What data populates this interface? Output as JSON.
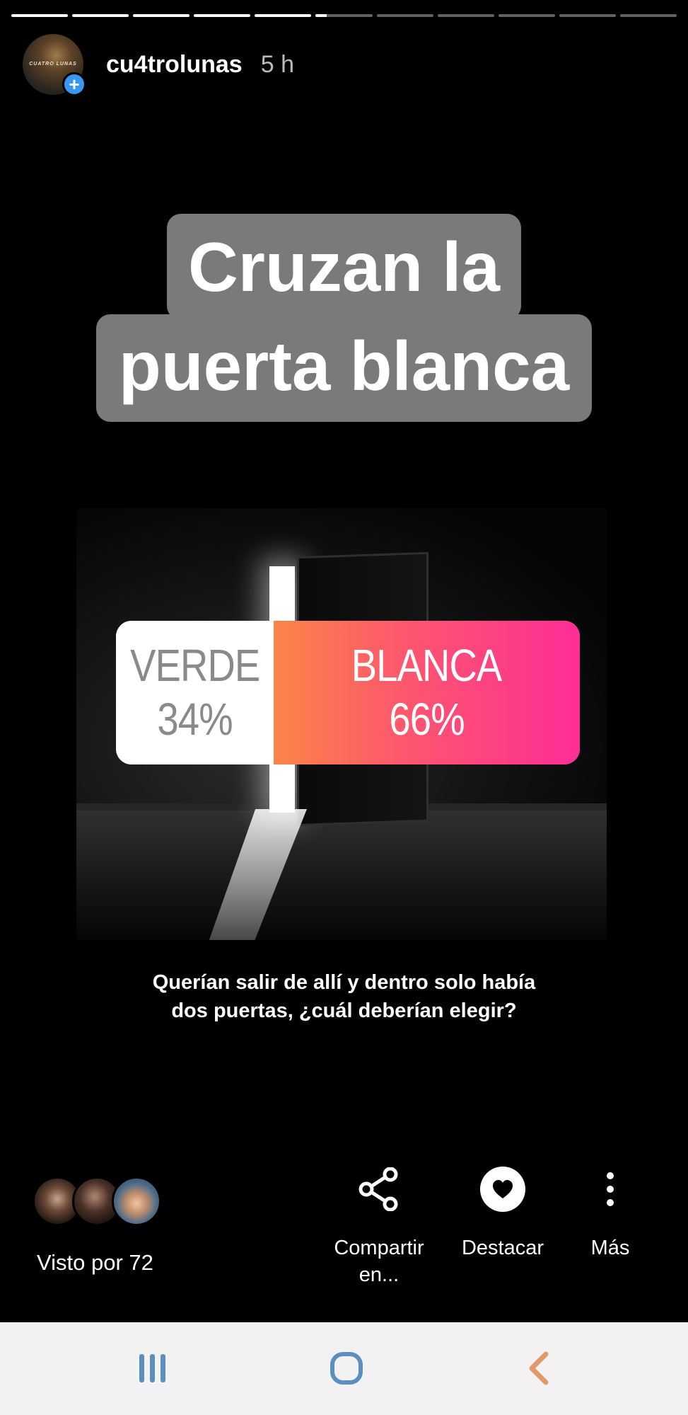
{
  "story": {
    "username": "cu4trolunas",
    "timestamp": "5 h",
    "avatar_text": "CUATRO LUNAS",
    "progress": {
      "segment_count": 11,
      "completed_segments": 5,
      "current_segment_fill": 0.2
    }
  },
  "title": {
    "line1": "Cruzan la",
    "line2": "puerta blanca"
  },
  "poll": {
    "options": [
      {
        "label": "VERDE",
        "percent": "34%",
        "value": 34
      },
      {
        "label": "BLANCA",
        "percent": "66%",
        "value": 66
      }
    ]
  },
  "caption": {
    "line1": "Querían salir de allí y dentro solo había",
    "line2": "dos puertas, ¿cuál deberían elegir?"
  },
  "footer": {
    "seen_by": "Visto por 72",
    "actions": {
      "share_label_line1": "Compartir",
      "share_label_line2": "en...",
      "highlight_label": "Destacar",
      "more_label": "Más"
    }
  },
  "icons": {
    "share": "share-icon",
    "highlight": "heart-icon",
    "more": "more-vertical-icon",
    "recent": "recent-apps-icon",
    "home": "home-icon",
    "back": "back-icon",
    "add": "plus-icon"
  },
  "colors": {
    "background": "#000000",
    "title_box": "#7a7a7a",
    "poll_gradient_start": "#fb8446",
    "poll_gradient_end": "#fd2d96",
    "badge": "#3897f0",
    "nav_icons": "#5a8fbf",
    "back_icon": "#e39a6a"
  }
}
